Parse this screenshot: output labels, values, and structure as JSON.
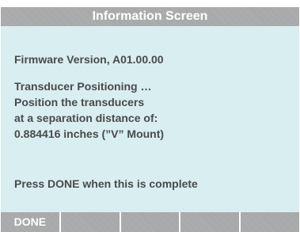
{
  "header": {
    "title": "Information Screen"
  },
  "content": {
    "firmware": "Firmware Version, A01.00.00",
    "instructions": [
      "Transducer Positioning …",
      "Position the transducers",
      "at a separation distance of:",
      "0.884416 inches (”V” Mount)"
    ],
    "prompt": "Press DONE when this is complete"
  },
  "softkeys": [
    "DONE",
    "",
    "",
    "",
    ""
  ],
  "colors": {
    "title_bar": "#9fa0a1",
    "panel_background": "#d9eef1",
    "text": "#4a4a4a",
    "softkey_text": "#ffffff"
  }
}
